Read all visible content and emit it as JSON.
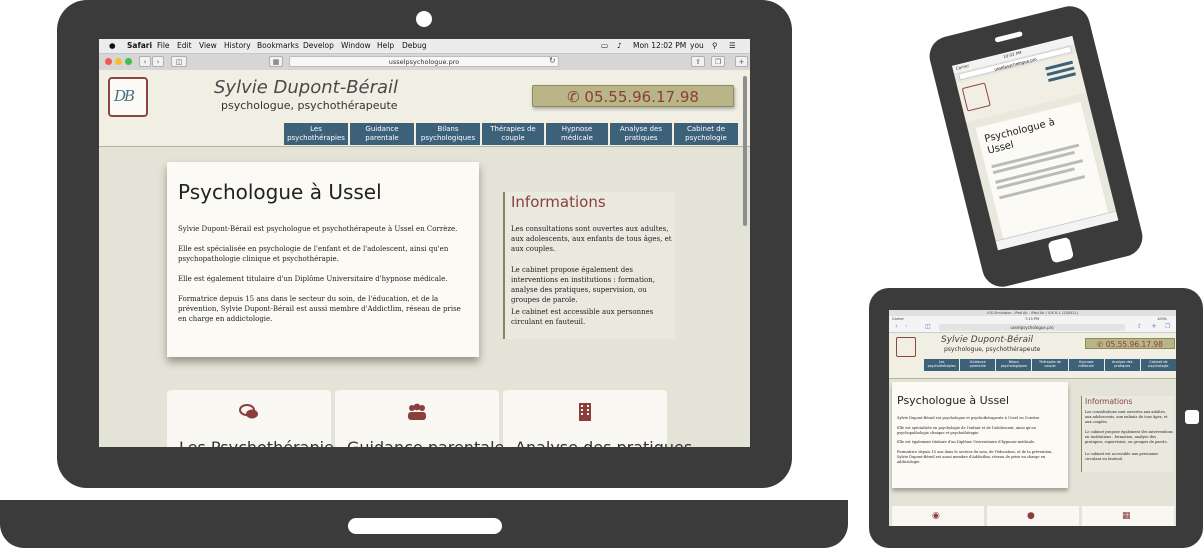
{
  "mac_menubar": {
    "apple": "",
    "app": "Safari",
    "items": [
      "File",
      "Edit",
      "View",
      "History",
      "Bookmarks",
      "Develop",
      "Window",
      "Help",
      "Debug"
    ],
    "clock": "Mon 12:02 PM",
    "user": "you"
  },
  "browser": {
    "url": "usselpsychologue.pro"
  },
  "site": {
    "name": "Sylvie Dupont-Bérail",
    "subtitle": "psychologue, psychothérapeute",
    "phone": "05.55.96.17.98",
    "nav": [
      {
        "line1": "Les",
        "line2": "psychothérapies"
      },
      {
        "line1": "Guidance",
        "line2": "parentale"
      },
      {
        "line1": "Bilans",
        "line2": "psychologiques"
      },
      {
        "line1": "Thérapies de",
        "line2": "couple"
      },
      {
        "line1": "Hypnose",
        "line2": "médicale"
      },
      {
        "line1": "Analyse des",
        "line2": "pratiques"
      },
      {
        "line1": "Cabinet de",
        "line2": "psychologie"
      }
    ],
    "main": {
      "title": "Psychologue à Ussel",
      "paragraphs": [
        "Sylvie Dupont-Bérail est psychologue et psychothérapeute à Ussel en Corrèze.",
        "Elle est spécialisée en psychologie de l'enfant et de l'adolescent, ainsi qu'en psychopathologie clinique et psychothérapie.",
        "Elle est également titulaire d'un Diplôme Universitaire d'hypnose médicale.",
        "Formatrice depuis 15 ans dans le secteur du soin, de l'éducation, et de la prévention, Sylvie Dupont-Bérail est aussi membre d'Addictlim, réseau de prise en charge en addictologie."
      ]
    },
    "info": {
      "title": "Informations",
      "paragraphs": [
        "Les consultations sont ouvertes aux adultes, aux adolescents, aux enfants de tous âges, et aux couples.",
        "Le cabinet propose également des interventions en institutions : formation, analyse des pratiques, supervision, ou groupes de parole.",
        "Le cabinet est accessible aux personnes circulant en fauteuil."
      ]
    },
    "features": [
      {
        "icon": "comments-icon",
        "title": "Les Psychothérapies"
      },
      {
        "icon": "users-icon",
        "title": "Guidance parentale"
      },
      {
        "icon": "building-icon",
        "title": "Analyse des pratiques"
      }
    ]
  },
  "phone": {
    "carrier": "Carrier",
    "time": "10:02 PM",
    "url": "usselpsychologue.pro",
    "title": "Psychologue à Ussel"
  },
  "tablet": {
    "carrier": "Carrier",
    "time": "7:15 PM",
    "sim_title": "iOS Simulator - iPad Air - iPad Air / iOS 8.1 (12B411)",
    "url": "usselpsychologue.pro",
    "battery": "100%"
  },
  "colors": {
    "accent": "#8a3e3e",
    "nav": "#3e617a",
    "phone_button": "#b9b586",
    "background": "#e4e3d7"
  }
}
